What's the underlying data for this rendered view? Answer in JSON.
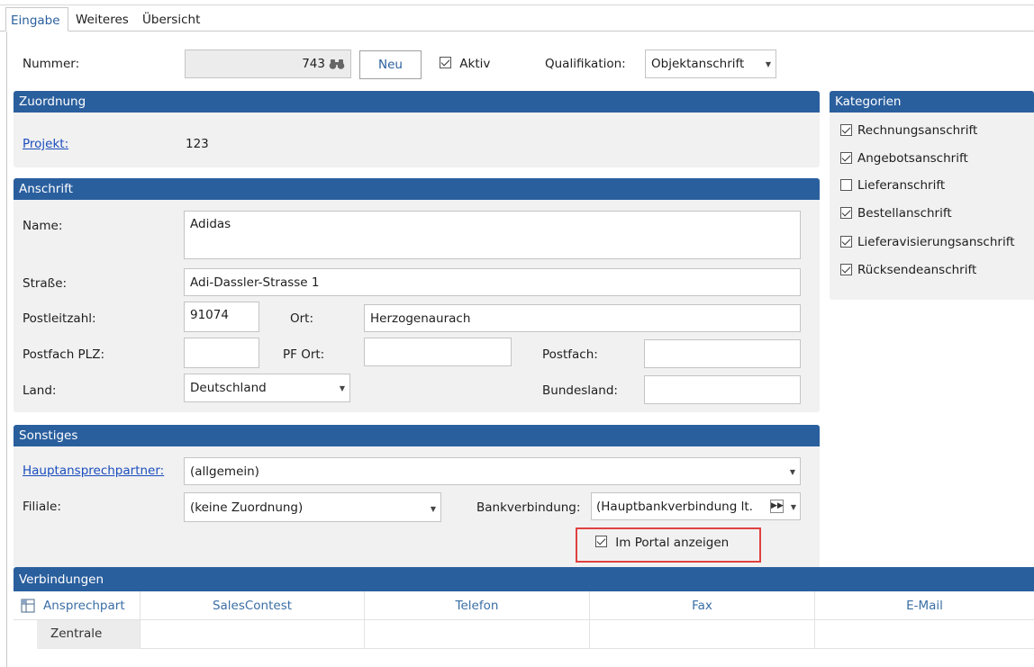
{
  "tabs": [
    {
      "label": "Eingabe",
      "active": true
    },
    {
      "label": "Weiteres",
      "active": false
    },
    {
      "label": "Übersicht",
      "active": false
    }
  ],
  "header": {
    "nummer_label": "Nummer:",
    "nummer_value": "743",
    "neu_label": "Neu",
    "aktiv_label": "Aktiv",
    "aktiv_checked": true,
    "qualifikation_label": "Qualifikation:",
    "qualifikation_value": "Objektanschrift"
  },
  "zuordnung": {
    "title": "Zuordnung",
    "projekt_label": "Projekt:",
    "projekt_value": "123"
  },
  "anschrift": {
    "title": "Anschrift",
    "name_label": "Name:",
    "name_value": "Adidas",
    "strasse_label": "Straße:",
    "strasse_value": "Adi-Dassler-Strasse 1",
    "plz_label": "Postleitzahl:",
    "plz_value": "91074",
    "ort_label": "Ort:",
    "ort_value": "Herzogenaurach",
    "postfach_plz_label": "Postfach PLZ:",
    "postfach_plz_value": "",
    "pf_ort_label": "PF Ort:",
    "pf_ort_value": "",
    "postfach_label": "Postfach:",
    "postfach_value": "",
    "land_label": "Land:",
    "land_value": "Deutschland",
    "bundesland_label": "Bundesland:",
    "bundesland_value": ""
  },
  "sonstiges": {
    "title": "Sonstiges",
    "hauptansprechpartner_label": "Hauptansprechpartner:",
    "hauptansprechpartner_value": "(allgemein)",
    "filiale_label": "Filiale:",
    "filiale_value": "(keine Zuordnung)",
    "bankverbindung_label": "Bankverbindung:",
    "bankverbindung_value": "(Hauptbankverbindung lt.",
    "portal_label": "Im Portal anzeigen",
    "portal_checked": true
  },
  "kategorien": {
    "title": "Kategorien",
    "items": [
      {
        "label": "Rechnungsanschrift",
        "checked": true
      },
      {
        "label": "Angebotsanschrift",
        "checked": true
      },
      {
        "label": "Lieferanschrift",
        "checked": false
      },
      {
        "label": "Bestellanschrift",
        "checked": true
      },
      {
        "label": "Lieferavisierungsanschrift",
        "checked": true
      },
      {
        "label": "Rücksendeanschrift",
        "checked": true
      }
    ]
  },
  "verbindungen": {
    "title": "Verbindungen",
    "columns": [
      "Ansprechpart",
      "SalesContest",
      "Telefon",
      "Fax",
      "E-Mail"
    ],
    "rows": [
      [
        "Zentrale",
        "",
        "",
        "",
        ""
      ]
    ]
  },
  "colors": {
    "panel_header": "#2a5f9e",
    "panel_body": "#f1f1f1",
    "link": "#1a4dbd",
    "highlight": "#e04040"
  }
}
